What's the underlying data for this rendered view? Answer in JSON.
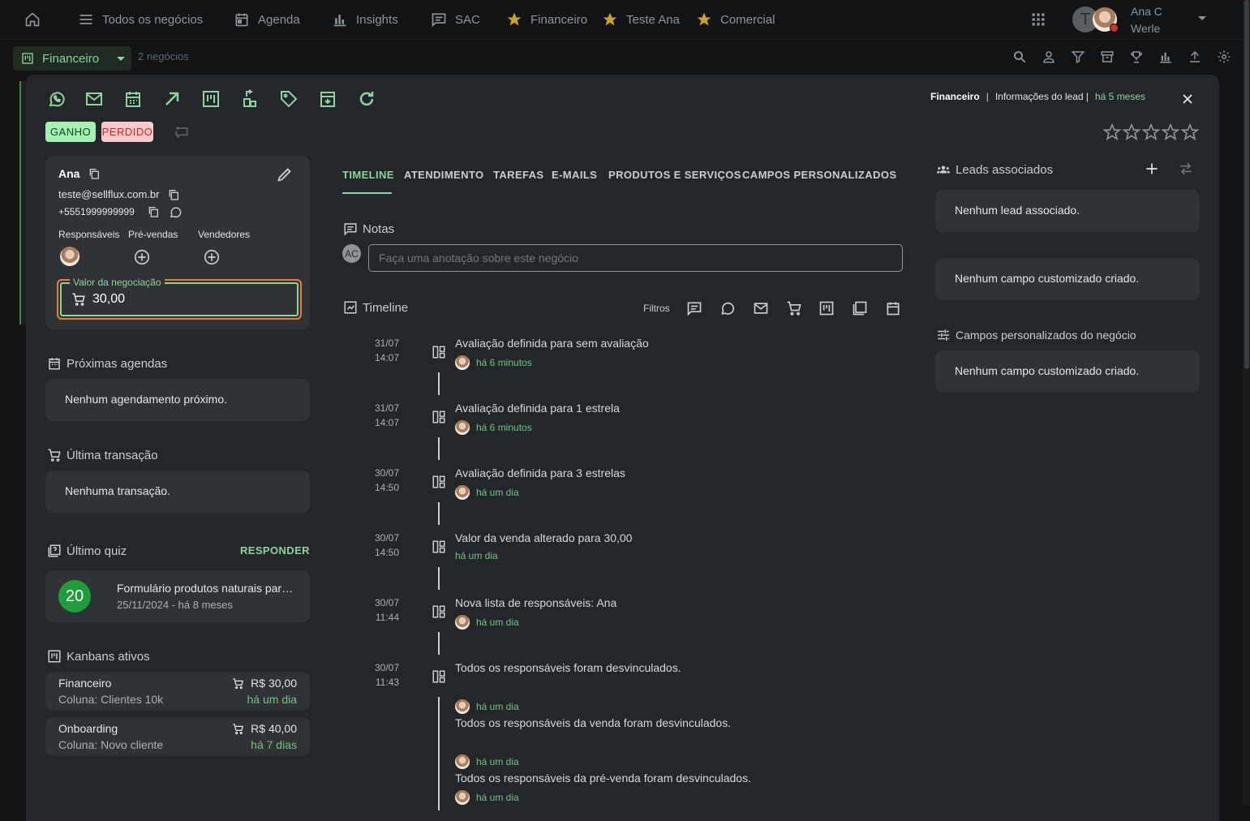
{
  "nav": {
    "items": [
      {
        "label": "Todos os negócios",
        "icon": "menu-icon"
      },
      {
        "label": "Agenda",
        "icon": "calendar-icon"
      },
      {
        "label": "Insights",
        "icon": "bar-chart-icon"
      },
      {
        "label": "SAC",
        "icon": "chat-icon"
      },
      {
        "label": "Financeiro",
        "icon": "star-icon"
      },
      {
        "label": "Teste Ana",
        "icon": "star-icon"
      },
      {
        "label": "Comercial",
        "icon": "star-icon"
      }
    ],
    "user_initial": "T",
    "user_name_line1": "Ana C",
    "user_name_line2": "Werle"
  },
  "subbar": {
    "kanban": "Financeiro",
    "count": "2 negócios"
  },
  "header": {
    "pipeline": "Financeiro",
    "separator": "|",
    "info": "Informações do lead |",
    "time": "há 5 meses"
  },
  "status": {
    "won": "GANHO",
    "lost": "PERDIDO"
  },
  "lead": {
    "name": "Ana",
    "email": "teste@sellflux.com.br",
    "phone": "+5551999999999",
    "responsaveis": "Responsáveis",
    "pre_vendas": "Pré-vendas",
    "vendedores": "Vendedores",
    "valor_label": "Valor da negociação",
    "valor": "30,00"
  },
  "agendas": {
    "title": "Próximas agendas",
    "empty": "Nenhum agendamento próximo."
  },
  "transacao": {
    "title": "Última transação",
    "empty": "Nenhuma transação."
  },
  "quiz": {
    "title": "Último quiz",
    "action": "RESPONDER",
    "score": "20",
    "name": "Formulário produtos naturais par…",
    "meta": "25/11/2024 - há 8 meses"
  },
  "kanbans": {
    "title": "Kanbans ativos",
    "items": [
      {
        "name": "Financeiro",
        "column": "Coluna: Clientes 10k",
        "value": "R$ 30,00",
        "time": "há um dia"
      },
      {
        "name": "Onboarding",
        "column": "Coluna: Novo cliente",
        "value": "R$ 40,00",
        "time": "há 7 dias"
      }
    ]
  },
  "tabs": [
    "TIMELINE",
    "ATENDIMENTO",
    "TAREFAS",
    "E-MAILS",
    "PRODUTOS E SERVIÇOS",
    "CAMPOS PERSONALIZADOS"
  ],
  "notes": {
    "title": "Notas",
    "avatar": "AC",
    "placeholder": "Faça uma anotação sobre este negócio"
  },
  "timeline": {
    "title": "Timeline",
    "filters_label": "Filtros",
    "events": [
      {
        "date": "31/07",
        "time": "14:07",
        "text": "Avaliação definida para sem avaliação",
        "ago": "há 6 minutos"
      },
      {
        "date": "31/07",
        "time": "14:07",
        "text": "Avaliação definida para 1 estrela",
        "ago": "há 6 minutos"
      },
      {
        "date": "30/07",
        "time": "14:50",
        "text": "Avaliação definida para 3 estrelas",
        "ago": "há um dia"
      },
      {
        "date": "30/07",
        "time": "14:50",
        "text": "Valor da venda alterado para 30,00",
        "ago": "há um dia"
      },
      {
        "date": "30/07",
        "time": "11:44",
        "text": "Nova lista de responsáveis: Ana",
        "ago": "há um dia"
      },
      {
        "date": "30/07",
        "time": "11:43",
        "text": "Todos os responsáveis foram desvinculados.",
        "ago": ""
      }
    ],
    "sub_events": [
      {
        "ago": "há um dia",
        "text": "Todos os responsáveis da venda foram desvinculados."
      },
      {
        "ago": "há um dia",
        "text": "Todos os responsáveis da pré-venda foram desvinculados."
      },
      {
        "ago": "há um dia",
        "text": ""
      }
    ]
  },
  "right": {
    "leads_title": "Leads associados",
    "leads_empty": "Nenhum lead associado.",
    "custom_empty": "Nenhum campo customizado criado.",
    "campos_title": "Campos personalizados do negócio",
    "campos_empty": "Nenhum campo customizado criado."
  },
  "colors": {
    "accent_green": "#8fd29e",
    "time_green": "#72c285",
    "focus_orange": "#f07a3a",
    "won_bg": "#a7f0b4",
    "lost_bg": "#ffc9c9"
  }
}
